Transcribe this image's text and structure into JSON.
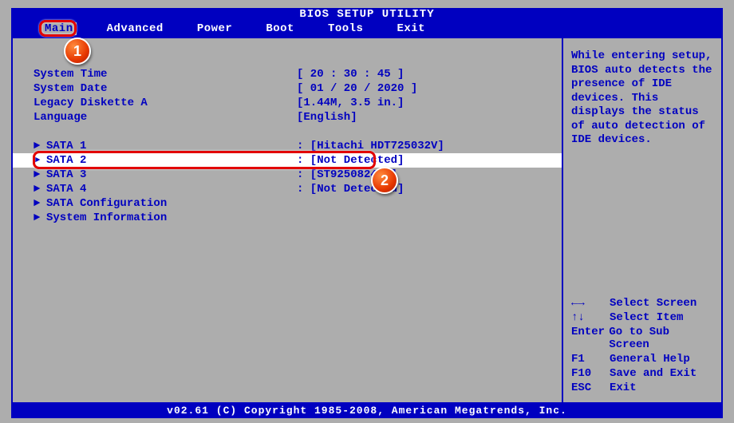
{
  "title": "BIOS SETUP UTILITY",
  "menu": {
    "items": [
      "Main",
      "Advanced",
      "Power",
      "Boot",
      "Tools",
      "Exit"
    ],
    "selected": "Main"
  },
  "main": {
    "rows": [
      {
        "type": "field",
        "label": "System Time",
        "value": "[ 20 : 30 : 45 ]"
      },
      {
        "type": "field",
        "label": "System Date",
        "value": "[ 01 / 20 / 2020 ]"
      },
      {
        "type": "field",
        "label": "Legacy Diskette A",
        "value": "[1.44M, 3.5 in.]"
      },
      {
        "type": "field",
        "label": "Language",
        "value": "[English]"
      },
      {
        "type": "spacer"
      },
      {
        "type": "sub",
        "label": "SATA 1",
        "value": ": [Hitachi HDT725032V]"
      },
      {
        "type": "sub",
        "label": "SATA 2",
        "value": ": [Not Detected]",
        "selected": true
      },
      {
        "type": "sub",
        "label": "SATA 3",
        "value": ": [ST9250824AS]"
      },
      {
        "type": "sub",
        "label": "SATA 4",
        "value": ": [Not Detected]"
      },
      {
        "type": "sub",
        "label": "SATA Configuration",
        "value": ""
      },
      {
        "type": "sub",
        "label": "System Information",
        "value": ""
      }
    ]
  },
  "help": {
    "text": "While entering setup, BIOS auto detects the presence of IDE devices. This displays the status of auto detection of IDE devices.",
    "keys": [
      {
        "key": "←→",
        "desc": "Select Screen"
      },
      {
        "key": "↑↓",
        "desc": "Select Item"
      },
      {
        "key": "Enter",
        "desc": "Go to Sub Screen"
      },
      {
        "key": "F1",
        "desc": "General Help"
      },
      {
        "key": "F10",
        "desc": "Save and Exit"
      },
      {
        "key": "ESC",
        "desc": "Exit"
      }
    ]
  },
  "footer": "v02.61 (C) Copyright 1985-2008, American Megatrends, Inc.",
  "annotations": {
    "callout1": "1",
    "callout2": "2"
  }
}
